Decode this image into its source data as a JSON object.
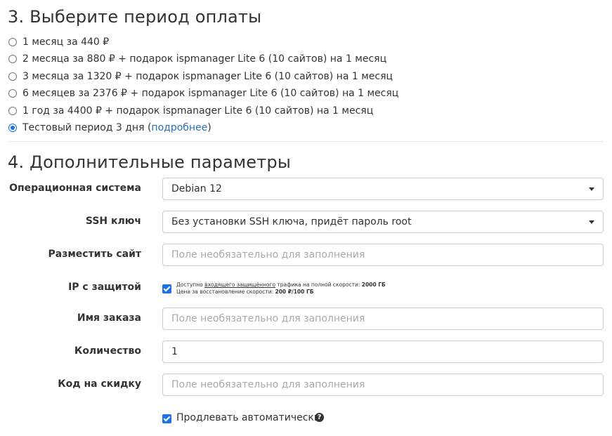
{
  "section3": {
    "title": "3. Выберите период оплаты",
    "options": [
      {
        "label": "1 месяц за 440 ₽",
        "checked": false
      },
      {
        "label": "2 месяца за 880 ₽ + подарок ispmanager Lite 6 (10 сайтов) на 1 месяц",
        "checked": false
      },
      {
        "label": "3 месяца за 1320 ₽ + подарок ispmanager Lite 6 (10 сайтов) на 1 месяц",
        "checked": false
      },
      {
        "label": "6 месяцев за 2376 ₽ + подарок ispmanager Lite 6 (10 сайтов) на 1 месяц",
        "checked": false
      },
      {
        "label": "1 год за 4400 ₽ + подарок ispmanager Lite 6 (10 сайтов) на 1 месяц",
        "checked": false
      },
      {
        "label": "Тестовый период 3 дня (",
        "link": "подробнее",
        "suffix": ")",
        "checked": true
      }
    ]
  },
  "section4": {
    "title": "4. Дополнительные параметры",
    "os": {
      "label": "Операционная система",
      "value": "Debian 12"
    },
    "ssh": {
      "label": "SSH ключ",
      "value": "Без установки SSH ключа, придёт пароль root"
    },
    "site": {
      "label": "Разместить сайт",
      "placeholder": "Поле необязательно для заполнения"
    },
    "ip": {
      "label": "IP с защитой",
      "checked": true,
      "line1_a": "Доступно ",
      "line1_u": "входящего защищённого",
      "line1_b": " трафика на полной скорости: ",
      "line1_bold": "2000 ГБ",
      "line2_a": "Цена за восстановление скорости: ",
      "line2_bold": "200 ₽/100 ГБ"
    },
    "order_name": {
      "label": "Имя заказа",
      "placeholder": "Поле необязательно для заполнения"
    },
    "quantity": {
      "label": "Количество",
      "value": "1"
    },
    "discount": {
      "label": "Код на скидку",
      "placeholder": "Поле необязательно для заполнения"
    },
    "autorenew": {
      "label": "Продлевать автоматически",
      "checked": true
    }
  },
  "colors": {
    "accent": "#1a73e8",
    "link": "#2a6ebb"
  },
  "icons": {
    "help": "question-circle-icon",
    "caret": "caret-down-icon"
  }
}
